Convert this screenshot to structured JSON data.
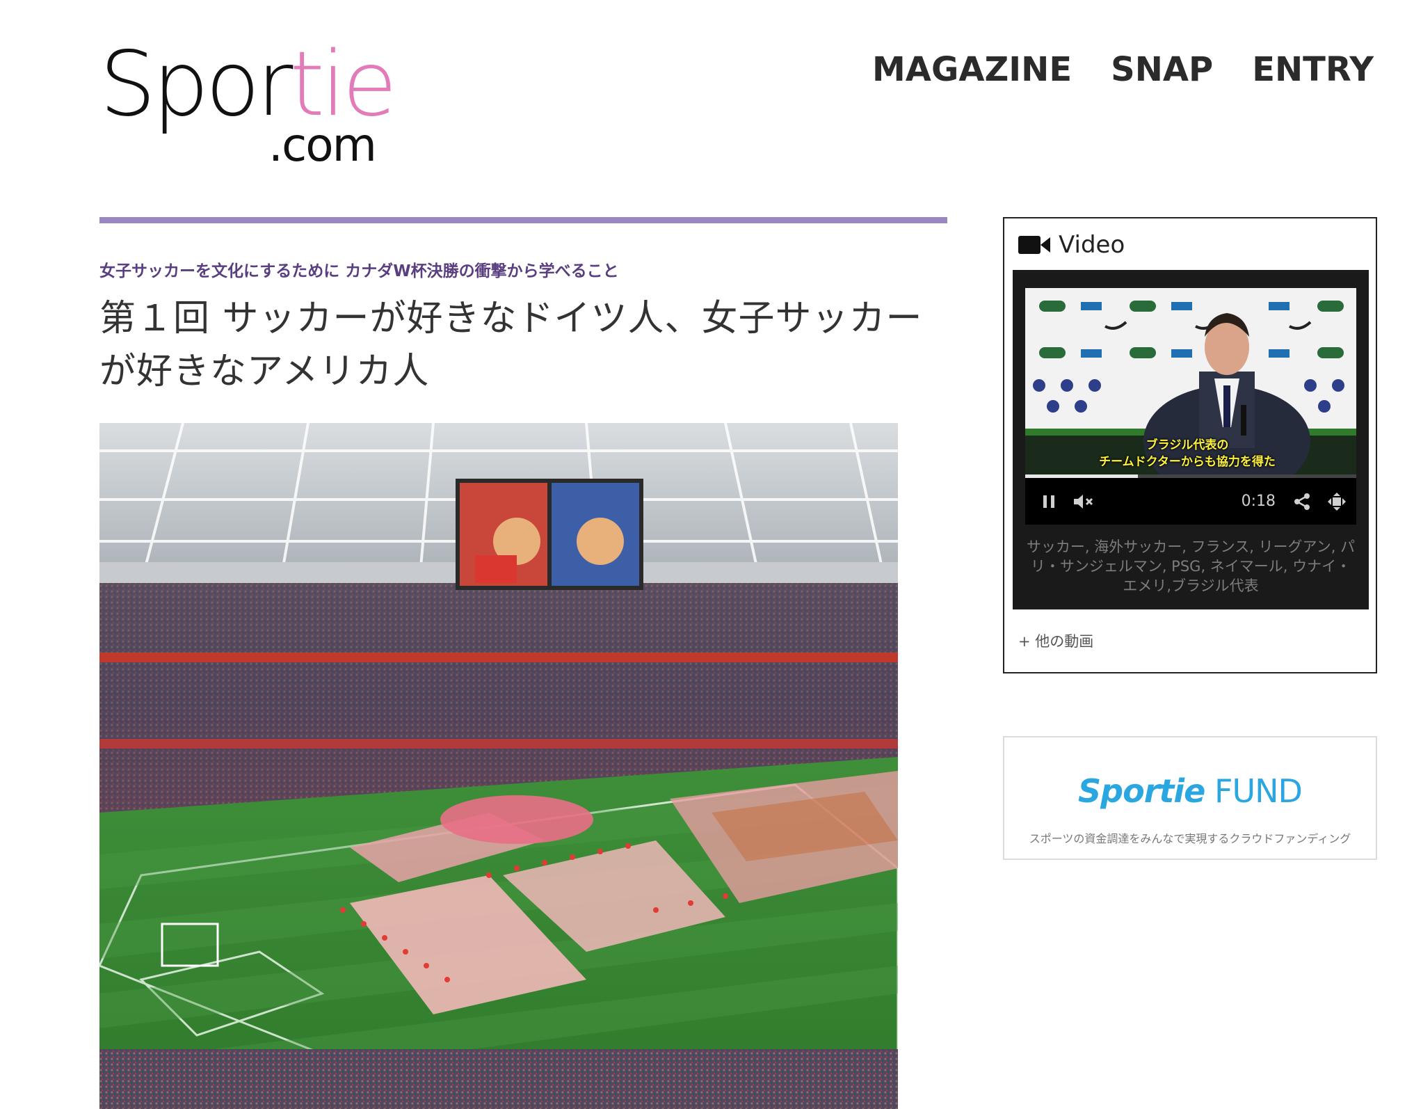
{
  "header": {
    "logo": {
      "main_a": "Spor",
      "main_b": "tie",
      "sub": ".com"
    },
    "nav": [
      {
        "label": "MAGAZINE"
      },
      {
        "label": "SNAP"
      },
      {
        "label": "ENTRY"
      }
    ]
  },
  "article": {
    "series": "女子サッカーを文化にするために カナダW杯決勝の衝撃から学べること",
    "title": "第１回 サッカーが好きなドイツ人、女子サッカーが好きなアメリカ人"
  },
  "sidebar": {
    "video": {
      "heading": "Video",
      "subtitle_line1": "ブラジル代表の",
      "subtitle_line2": "チームドクターからも協力を得た",
      "time": "0:18",
      "progress": 0.34,
      "tags": "サッカー, 海外サッカー, フランス, リーグアン, パリ・サンジェルマン, PSG, ネイマール, ウナイ・エメリ,ブラジル代表",
      "more_link": "+ 他の動画"
    },
    "fund": {
      "logo_a": "Sportie",
      "logo_b": " FUND",
      "tagline": "スポーツの資金調達をみんなで実現するクラウドファンディング"
    }
  },
  "colors": {
    "accent_purple": "#9a86c0",
    "series_purple": "#5a3f80",
    "logo_pink": "#e27bb7",
    "fund_blue": "#2aa7e0"
  }
}
